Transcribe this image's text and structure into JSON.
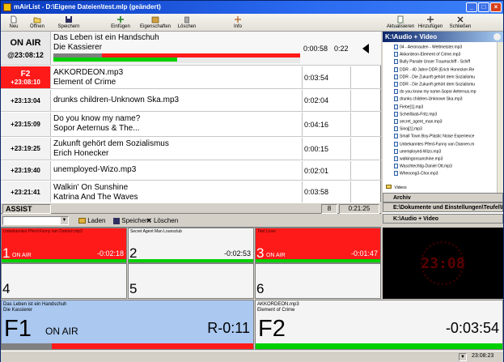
{
  "window": {
    "title": "mAirList - D:\\Eigene Dateien\\test.mlp (geändert)"
  },
  "toolbar": {
    "items": [
      {
        "label": "Neu",
        "icon": "new-document-icon"
      },
      {
        "label": "Öffnen",
        "icon": "open-folder-icon"
      },
      {
        "label": "Speichern",
        "icon": "save-icon"
      },
      {
        "label": "Einfügen",
        "icon": "insert-icon"
      },
      {
        "label": "Eigenschaften",
        "icon": "properties-icon"
      },
      {
        "label": "Löschen",
        "icon": "delete-icon"
      },
      {
        "label": "Info",
        "icon": "info-icon"
      }
    ],
    "right_items": [
      {
        "label": "Aktualisieren",
        "icon": "refresh-icon"
      },
      {
        "label": "Hinzufügen",
        "icon": "add-icon"
      },
      {
        "label": "Schließen",
        "icon": "close-icon"
      }
    ]
  },
  "playlist": {
    "onair": {
      "status": "ON AIR",
      "time": "@23:08:12",
      "title": "Das Leben ist ein Handschuh",
      "artist": "Die Kassierer",
      "elapsed": "0:00:58",
      "remaining": "0:22",
      "progress": 0.5
    },
    "rows": [
      {
        "time_top": "F2",
        "time": "+23:08:10",
        "line1": "AKKORDEON.mp3",
        "line2": "Element of Crime",
        "duration": "0:03:54",
        "highlight": true
      },
      {
        "time": "+23:13:04",
        "line1": "drunks children-Unknown Ska.mp3",
        "line2": "",
        "duration": "0:02:04"
      },
      {
        "time": "+23:15:09",
        "line1": "Do you know my name?",
        "line2": "Sopor Aeternus & The...",
        "duration": "0:04:16"
      },
      {
        "time": "+23:19:25",
        "line1": "Zukunft gehört dem Sozialismus",
        "line2": "Erich Honecker",
        "duration": "0:00:15"
      },
      {
        "time": "+23:19:40",
        "line1": "unemployed-Wizo.mp3",
        "line2": "",
        "duration": "0:02:01"
      },
      {
        "time": "+23:21:41",
        "line1": "Walkin' On Sunshine",
        "line2": "Katrina And The Waves",
        "duration": "0:03:58"
      }
    ]
  },
  "assist": {
    "label": "ASSIST",
    "count": "8",
    "total": "0:21:25"
  },
  "cartbar": {
    "load": "Laden",
    "save": "Speichern",
    "delete": "Löschen"
  },
  "browser": {
    "path": "K:\\Audio + Video",
    "files": [
      "04 - Aeronauten - Weltmeister.mp3",
      "Akkordeon-Element of Crime.mp3",
      "Bully Parade  Unser Traumschiff  - Schiff",
      "DDR - 40 Jahre DDR (Erich Honecker-Re",
      "DDR - Die Zukunft gehört dem Sozialismu",
      "DDR - Die Zukunft gehört dem Sozialismu",
      "do you know my name-Sopor Aeternus.mp",
      "drunks children-Unknown Ska.mp3",
      "Fiebe[1].mp3",
      "Scheißkab-Fritz.mp3",
      "secret_agent_man.mp3",
      "Sinoj[1].mp3",
      "Small Town Boy-Plastic Noise Experience",
      "Unbekanntes Pferd-Funny van Dannen.m",
      "unemployed-Wizo.mp3",
      "walkingonsunshine.mp3",
      "Waschtechtig-Daniel Ott.mp3",
      "Wheoong3-Chor.mp3"
    ],
    "folder": "Videos",
    "tabs": [
      "Archiv",
      "E:\\Dokumente und Einstellungen\\Teufel\\De",
      "K:\\Audio + Video"
    ]
  },
  "carts": [
    {
      "num": "1",
      "title": "Unbekanntes Pferd-Funny van Dannen.mp3",
      "status": "ON AIR",
      "time": "-0:02:18",
      "active": true
    },
    {
      "num": "2",
      "title": "Secret Agent Man\nLounsclub",
      "status": "",
      "time": "-0:02:53",
      "active": false
    },
    {
      "num": "3",
      "title": "Titel\nLoser",
      "status": "ON AIR",
      "time": "-0:01:47",
      "active": true
    },
    {
      "num": "4",
      "title": "",
      "status": "",
      "time": "",
      "active": false
    },
    {
      "num": "5",
      "title": "",
      "status": "",
      "time": "",
      "active": false
    },
    {
      "num": "6",
      "title": "",
      "status": "",
      "time": "",
      "active": false
    }
  ],
  "clock": {
    "display": "23:08"
  },
  "players": [
    {
      "id": "F1",
      "title": "Das Leben ist ein Handschuh",
      "artist": "Die Kassierer",
      "status": "ON AIR",
      "time": "R-0:11"
    },
    {
      "id": "F2",
      "title": "AKKORDEON.mp3",
      "artist": "Element of Crime",
      "status": "",
      "time": "-0:03:54"
    }
  ],
  "status": {
    "time": "23:08:23"
  },
  "colors": {
    "onair_red": "#ff1a1a",
    "meter_green": "#00d000",
    "player_blue": "#aac8f0"
  }
}
